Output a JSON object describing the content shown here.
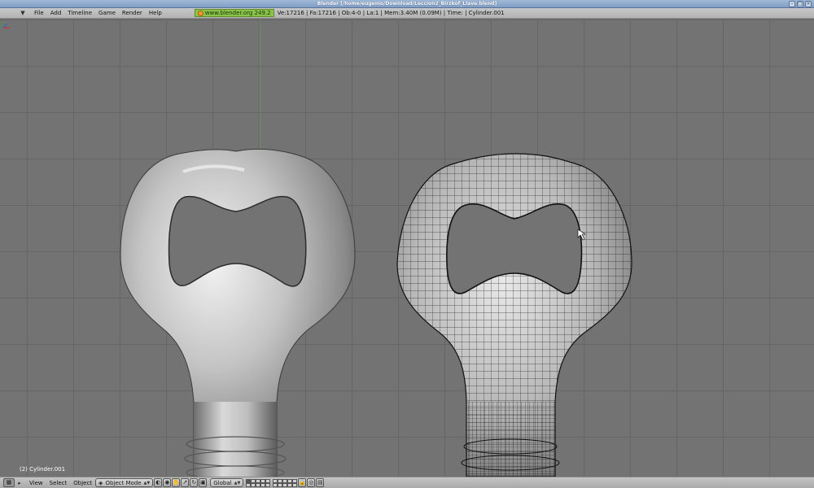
{
  "window": {
    "title": "Blender [/home/eugenio/Download/Leccion2_Birzkof_Llave.blend]"
  },
  "menubar": {
    "items": [
      "File",
      "Add",
      "Timeline",
      "Game",
      "Render",
      "Help"
    ],
    "site_badge": "www.blender.org 249.2",
    "stats": "Ve:17216 | Fa:17216 | Ob:4-0 | La:1  | Mem:3.40M (0.09M)  | Time: | Cylinder.001"
  },
  "viewport": {
    "object_label": "(2) Cylinder.001",
    "left_object": "solid shaded bottle opener",
    "right_object": "wireframe bottle opener mesh"
  },
  "bottombar": {
    "items": [
      "View",
      "Select",
      "Object"
    ],
    "mode": "Object Mode",
    "orientation": "Global"
  },
  "colors": {
    "viewport_bg": "#737373",
    "grid": "#666666",
    "menubar": "#bdbdbd",
    "badge": "#8bc34a"
  }
}
